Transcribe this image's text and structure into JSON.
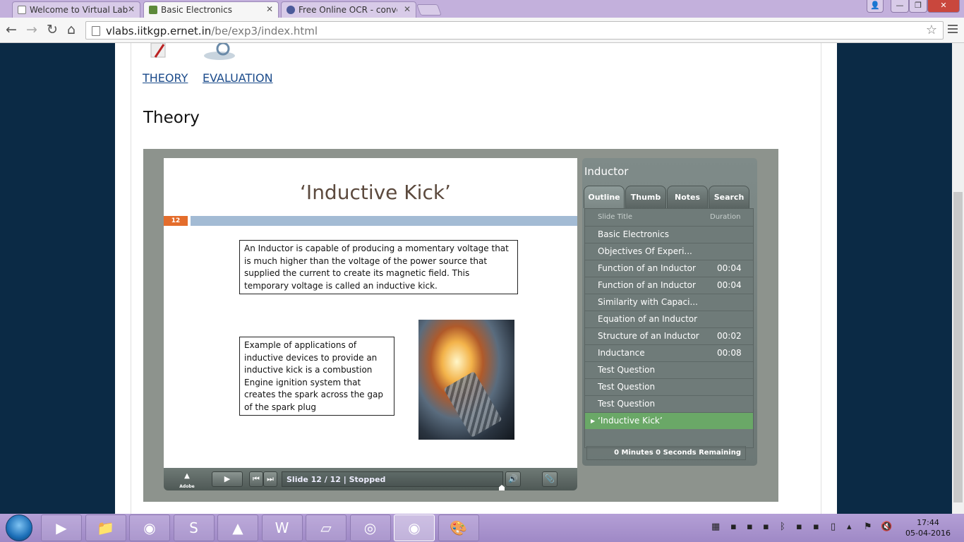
{
  "tabs": [
    {
      "label": "Welcome to Virtual Labor",
      "active": false,
      "icon": "document-icon"
    },
    {
      "label": "Basic Electronics",
      "active": true,
      "icon": "vlabs-favicon-icon"
    },
    {
      "label": "Free Online OCR - convert",
      "active": false,
      "icon": "ocr-favicon-icon"
    }
  ],
  "window_controls": {
    "user": "👤",
    "minimize": "—",
    "maximize": "❐",
    "close": "✕"
  },
  "toolbar": {
    "back": "←",
    "forward": "→",
    "reload": "↻",
    "home": "⌂",
    "star": "☆"
  },
  "address": {
    "host": "vlabs.iitkgp.ernet.in",
    "path": "/be/exp3/index.html"
  },
  "page": {
    "nav_links": [
      "THEORY",
      "EVALUATION"
    ],
    "section_title": "Theory"
  },
  "slide": {
    "title": "‘Inductive Kick’",
    "number": "12",
    "text1": "An Inductor is capable of producing a momentary voltage that is much higher than the voltage of the power source that supplied the current to create its magnetic field. This temporary voltage is called an inductive kick.",
    "text2": "Example of applications of inductive devices to provide an inductive kick is a combustion Engine ignition system that creates the spark across the gap of the spark plug",
    "image": "spark-plug-image"
  },
  "player_controls": {
    "logo": "Adobe",
    "play": "▶",
    "prev": "⏮",
    "next": "⏭",
    "status": "Slide 12 / 12 | Stopped",
    "volume": "🔊",
    "attach": "📎"
  },
  "sidebar": {
    "title": "Inductor",
    "tabs": [
      "Outline",
      "Thumb",
      "Notes",
      "Search"
    ],
    "header_title": "Slide Title",
    "header_duration": "Duration",
    "rows": [
      {
        "title": "Basic Electronics",
        "duration": ""
      },
      {
        "title": "Objectives Of Experi...",
        "duration": ""
      },
      {
        "title": "Function of an Inductor",
        "duration": "00:04"
      },
      {
        "title": "Function of an Inductor",
        "duration": "00:04"
      },
      {
        "title": "Similarity with Capaci...",
        "duration": ""
      },
      {
        "title": "Equation of an Inductor",
        "duration": ""
      },
      {
        "title": "Structure of an Inductor",
        "duration": "00:02"
      },
      {
        "title": "Inductance",
        "duration": "00:08"
      },
      {
        "title": "Test Question",
        "duration": ""
      },
      {
        "title": "Test Question",
        "duration": ""
      },
      {
        "title": "Test Question",
        "duration": ""
      },
      {
        "title": "‘Inductive Kick’",
        "duration": "",
        "current": true
      }
    ],
    "remaining": "0 Minutes 0 Seconds Remaining"
  },
  "taskbar": {
    "apps": [
      {
        "name": "media-player-icon",
        "glyph": "▶"
      },
      {
        "name": "file-explorer-icon",
        "glyph": "📁"
      },
      {
        "name": "chrome-icon",
        "glyph": "◉"
      },
      {
        "name": "skype-icon",
        "glyph": "S"
      },
      {
        "name": "matlab-icon",
        "glyph": "▲"
      },
      {
        "name": "word-icon",
        "glyph": "W"
      },
      {
        "name": "notepad-icon",
        "glyph": "▱"
      },
      {
        "name": "firefox-icon",
        "glyph": "◎"
      },
      {
        "name": "chrome-active-icon",
        "glyph": "◉",
        "active": true
      },
      {
        "name": "paint-icon",
        "glyph": "🎨"
      }
    ],
    "time": "17:44",
    "date": "05-04-2016"
  },
  "colors": {
    "accent_orange": "#e46d2c",
    "slide_bar": "#a3bbd4",
    "current_row": "#6aa867",
    "player_bg": "#8d938d"
  }
}
